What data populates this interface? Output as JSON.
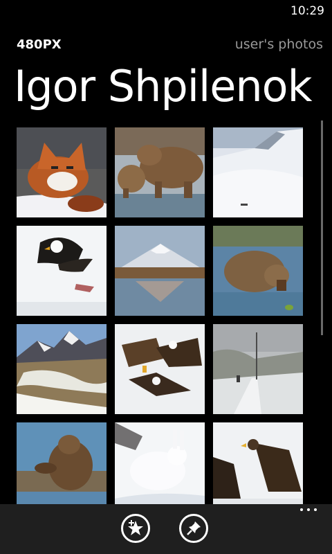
{
  "status": {
    "time": "10:29"
  },
  "header": {
    "app_name": "480PX",
    "section": "user's photos"
  },
  "page_title": "Igor Shpilenok",
  "photos": [
    {
      "subject": "red fox lying in snow"
    },
    {
      "subject": "brown bear and cub on ice"
    },
    {
      "subject": "snowy mountain slope"
    },
    {
      "subject": "eagle flying with fish"
    },
    {
      "subject": "volcano reflected in lake"
    },
    {
      "subject": "brown bear standing in water"
    },
    {
      "subject": "snow-patched mountains"
    },
    {
      "subject": "eagles fighting in snow"
    },
    {
      "subject": "person walking snowy path"
    },
    {
      "subject": "bear cub sitting in water"
    },
    {
      "subject": "white arctic hare"
    },
    {
      "subject": "eagles on snow"
    }
  ],
  "app_bar": {
    "buttons": [
      {
        "icon": "favorite-add-icon"
      },
      {
        "icon": "pin-icon"
      }
    ],
    "more_icon": "more-dots-icon"
  }
}
